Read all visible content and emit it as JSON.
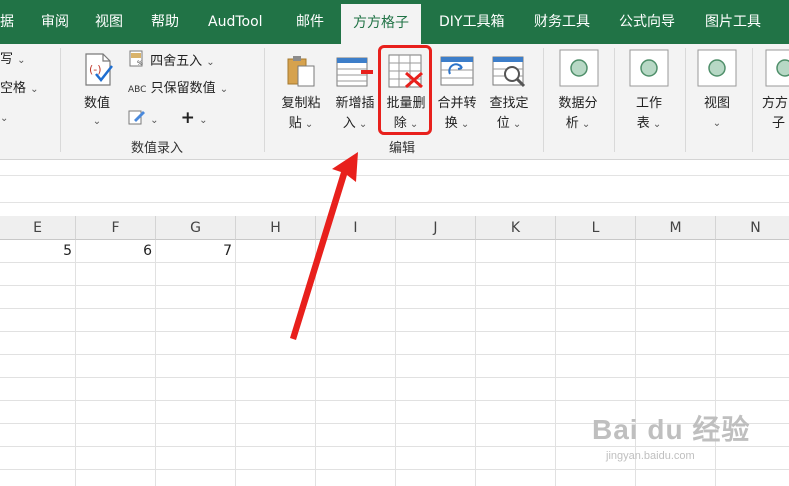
{
  "tabs": [
    {
      "label": "据"
    },
    {
      "label": "审阅"
    },
    {
      "label": "视图"
    },
    {
      "label": "帮助"
    },
    {
      "label": "AudTool"
    },
    {
      "label": "邮件"
    },
    {
      "label": "方方格子",
      "active": true
    },
    {
      "label": "DIY工具箱"
    },
    {
      "label": "财务工具"
    },
    {
      "label": "公式向导"
    },
    {
      "label": "图片工具"
    }
  ],
  "ribbon": {
    "left_partial": {
      "item1": "写",
      "item2": "空格"
    },
    "number_group": {
      "shuzhi": "数值",
      "round": "四舍五入",
      "keep_value": "只保留数值",
      "group_label": "数值录入"
    },
    "edit_group": {
      "copy_paste_line1": "复制粘",
      "copy_paste_line2": "贴",
      "insert_line1": "新增插",
      "insert_line2": "入",
      "batch_delete_line1": "批量删",
      "batch_delete_line2": "除",
      "merge_line1": "合并转",
      "merge_line2": "换",
      "find_line1": "查找定",
      "find_line2": "位",
      "group_label": "编辑"
    },
    "analysis": {
      "line1": "数据分",
      "line2": "析"
    },
    "worksheet": {
      "line1": "工作",
      "line2": "表"
    },
    "view": {
      "line1": "视图"
    },
    "grid_partial": {
      "line1": "方方",
      "line2": "子"
    }
  },
  "grid": {
    "columns": [
      "E",
      "F",
      "G",
      "H",
      "I",
      "J",
      "K",
      "L",
      "M",
      "N"
    ],
    "row1_values": [
      "5",
      "6",
      "7"
    ]
  },
  "colors": {
    "accent": "#217346",
    "highlight": "#e8201c"
  },
  "watermark": {
    "brand": "Bai du 经验",
    "url": "jingyan.baidu.com"
  }
}
